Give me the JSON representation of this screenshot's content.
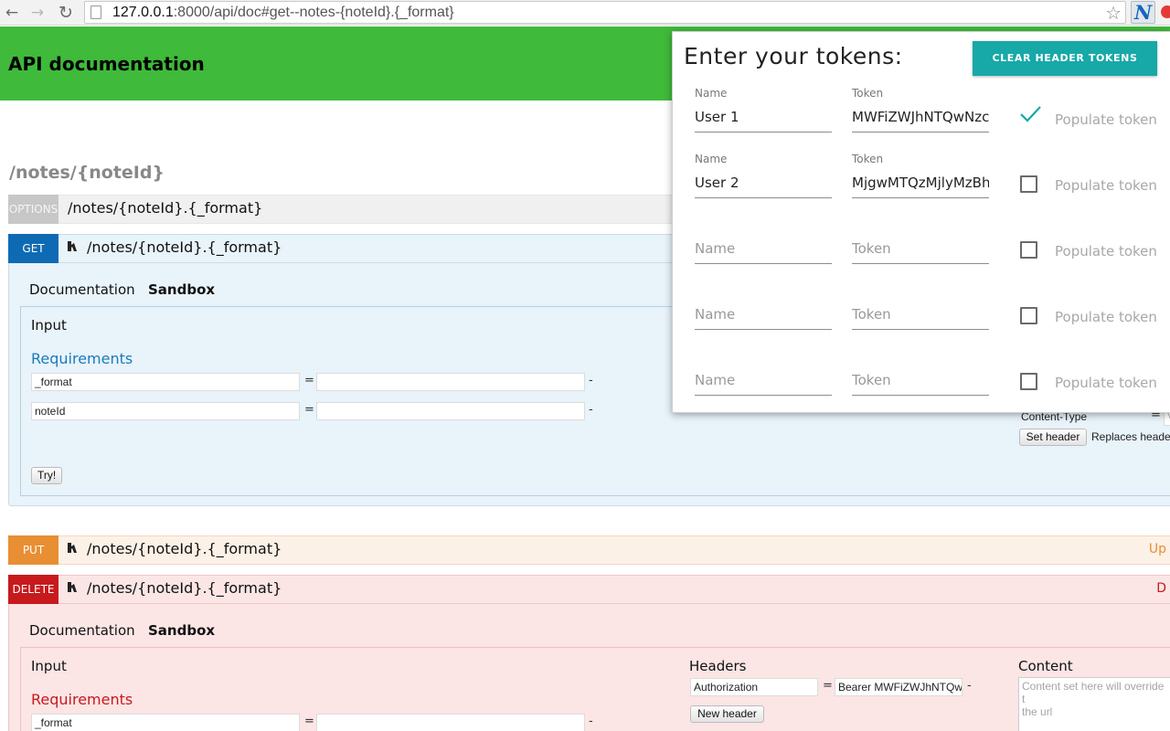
{
  "browser": {
    "url_host": "127.0.0.1",
    "url_rest": ":8000/api/doc#get--notes-{noteId}.{_format}",
    "extension_letter": "N"
  },
  "header": {
    "title": "API documentation"
  },
  "section": {
    "title": "/notes/{noteId}"
  },
  "routes": {
    "options": {
      "method": "OPTIONS",
      "path": "/notes/{noteId}.{_format}"
    },
    "get": {
      "method": "GET",
      "path": "/notes/{noteId}.{_format}"
    },
    "put": {
      "method": "PUT",
      "path": "/notes/{noteId}.{_format}",
      "desc": "Up"
    },
    "delete": {
      "method": "DELETE",
      "path": "/notes/{noteId}.{_format}",
      "desc": "D"
    }
  },
  "get_panel": {
    "tab_doc": "Documentation",
    "tab_sandbox": "Sandbox",
    "input_label": "Input",
    "requirements_label": "Requirements",
    "params": [
      {
        "name": "_format",
        "value": ""
      },
      {
        "name": "noteId",
        "value": ""
      }
    ],
    "eq": "=",
    "dash": "-",
    "try_label": "Try!",
    "content_type_label": "Content-Type",
    "content_type_value": "V",
    "set_header_label": "Set header",
    "replaces_text": "Replaces heade"
  },
  "delete_panel": {
    "tab_doc": "Documentation",
    "tab_sandbox": "Sandbox",
    "input_label": "Input",
    "requirements_label": "Requirements",
    "params": [
      {
        "name": "_format",
        "value": ""
      }
    ],
    "headers_label": "Headers",
    "header_name": "Authorization",
    "header_value": "Bearer MWFiZWJhNTQw",
    "new_header_label": "New header",
    "content_label": "Content",
    "content_placeholder_1": "Content set here will override t",
    "content_placeholder_2": "the url"
  },
  "popup": {
    "title": "Enter your tokens:",
    "clear_button": "CLEAR HEADER TOKENS",
    "name_small_label": "Name",
    "token_small_label": "Token",
    "name_placeholder": "Name",
    "token_placeholder": "Token",
    "populate_label": "Populate token",
    "rows": [
      {
        "name": "User 1",
        "token": "MWFiZWJhNTQwNzcx",
        "checked": true
      },
      {
        "name": "User 2",
        "token": "MjgwMTQzMjlyMzBh",
        "checked": false
      },
      {
        "name": "",
        "token": "",
        "checked": false
      },
      {
        "name": "",
        "token": "",
        "checked": false
      },
      {
        "name": "",
        "token": "",
        "checked": false
      }
    ]
  },
  "colors": {
    "header_green": "#3fba3a",
    "get_blue": "#0f6ab4",
    "put_orange": "#e88e33",
    "delete_red": "#c8191d",
    "teal_button": "#17a8a8"
  }
}
